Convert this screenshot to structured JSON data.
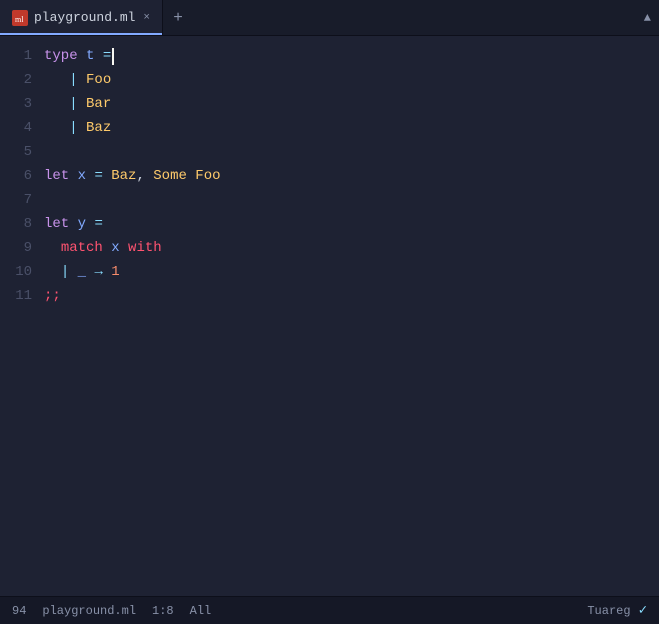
{
  "tab": {
    "filename": "playground.ml",
    "close_label": "×",
    "add_label": "+"
  },
  "lines": [
    {
      "num": "1",
      "content": "type_t_eq_cursor"
    },
    {
      "num": "2",
      "content": "pipe_Foo"
    },
    {
      "num": "3",
      "content": "pipe_Bar"
    },
    {
      "num": "4",
      "content": "pipe_Baz"
    },
    {
      "num": "5",
      "content": "empty"
    },
    {
      "num": "6",
      "content": "let_x_eq_Baz_Some_Foo"
    },
    {
      "num": "7",
      "content": "empty"
    },
    {
      "num": "8",
      "content": "let_y_eq"
    },
    {
      "num": "9",
      "content": "match_x_with"
    },
    {
      "num": "10",
      "content": "pipe_wildcard_arrow_1"
    },
    {
      "num": "11",
      "content": "semicolons"
    }
  ],
  "status": {
    "line_col": "1:8",
    "view": "All",
    "mode": "Tuareg",
    "encoding": "94"
  }
}
